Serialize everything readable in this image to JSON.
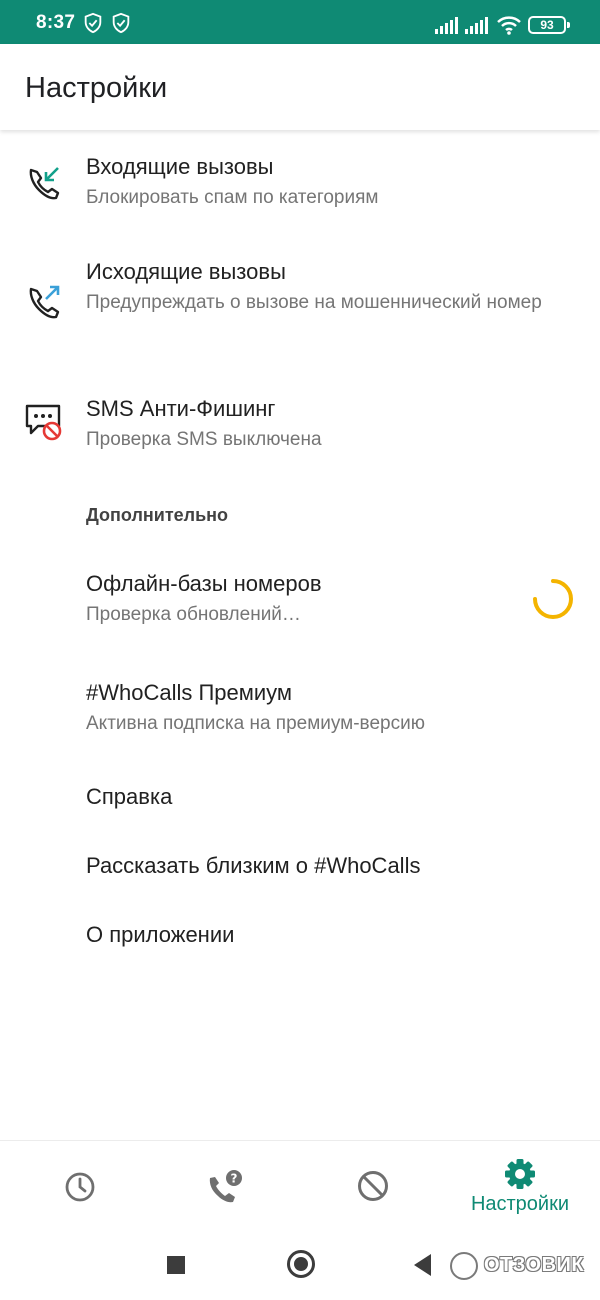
{
  "status_bar": {
    "time": "8:37",
    "battery": "93",
    "icons": [
      "shield-check-icon",
      "shield-check-icon",
      "signal-icon",
      "signal-icon",
      "wifi-icon",
      "battery-icon"
    ]
  },
  "app_bar": {
    "title": "Настройки"
  },
  "settings": {
    "incoming": {
      "title": "Входящие вызовы",
      "subtitle": "Блокировать спам по категориям",
      "icon": "incoming-call-icon"
    },
    "outgoing": {
      "title": "Исходящие вызовы",
      "subtitle": "Предупреждать о вызове на мошеннический номер",
      "icon": "outgoing-call-icon"
    },
    "sms": {
      "title": "SMS Анти-Фишинг",
      "subtitle": "Проверка SMS выключена",
      "icon": "sms-block-icon"
    }
  },
  "additional": {
    "header": "Дополнительно",
    "offline_db": {
      "title": "Офлайн-базы номеров",
      "subtitle": "Проверка обновлений…"
    },
    "premium": {
      "title": "#WhoCalls Премиум",
      "subtitle": "Активна подписка на премиум-версию"
    },
    "help": {
      "title": "Справка"
    },
    "share": {
      "title": "Рассказать близким о #WhoCalls"
    },
    "about": {
      "title": "О приложении"
    }
  },
  "bottom_nav": {
    "items": [
      {
        "icon": "history-icon"
      },
      {
        "icon": "call-question-icon"
      },
      {
        "icon": "block-icon"
      },
      {
        "icon": "gear-icon",
        "label": "Настройки",
        "active": true
      }
    ]
  },
  "watermark": {
    "text": "ОТЗОВИК"
  },
  "colors": {
    "status_bar": "#0f8a74",
    "accent": "#0f8a74",
    "spinner": "#f4b400",
    "incoming_arrow": "#11a08a",
    "outgoing_arrow": "#3aa0d8",
    "sms_block": "#e53935"
  }
}
